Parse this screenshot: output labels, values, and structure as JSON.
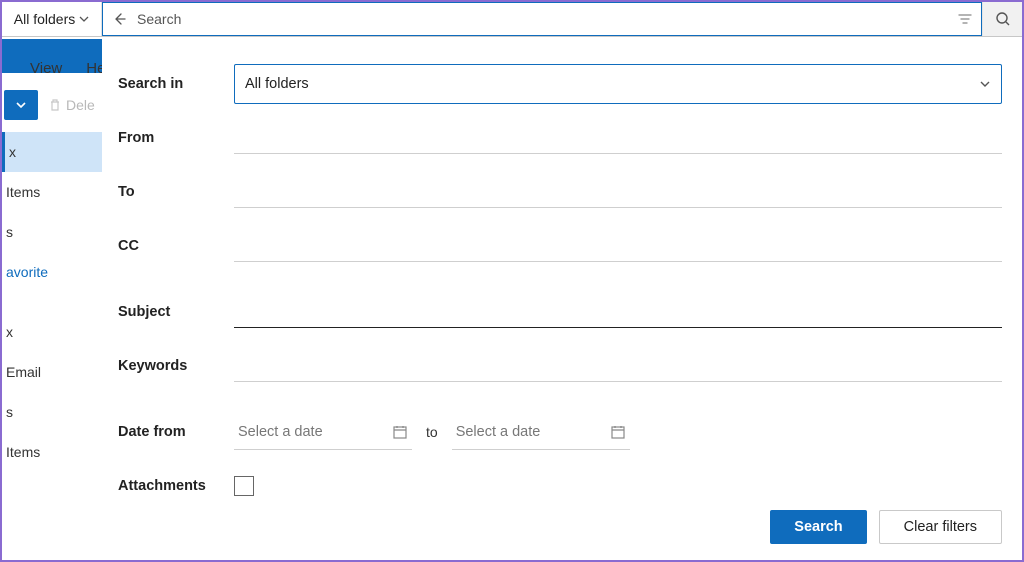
{
  "topbar": {
    "scope_label": "All folders",
    "search_placeholder": "Search"
  },
  "tabs": {
    "view": "View",
    "help_partial": "He"
  },
  "toolbar": {
    "delete_partial": "Dele"
  },
  "sidebar": {
    "items": [
      {
        "label": "x"
      },
      {
        "label": "Items"
      },
      {
        "label": "s"
      },
      {
        "label": "avorite"
      },
      {
        "label": "x"
      },
      {
        "label": "Email"
      },
      {
        "label": "s"
      },
      {
        "label": "Items"
      }
    ]
  },
  "panel": {
    "search_in": {
      "label": "Search in",
      "value": "All folders"
    },
    "from": {
      "label": "From"
    },
    "to": {
      "label": "To"
    },
    "cc": {
      "label": "CC"
    },
    "subject": {
      "label": "Subject"
    },
    "keywords": {
      "label": "Keywords"
    },
    "date": {
      "label": "Date from",
      "ph": "Select a date",
      "to_word": "to"
    },
    "attachments": {
      "label": "Attachments"
    },
    "buttons": {
      "search": "Search",
      "clear": "Clear filters"
    }
  }
}
